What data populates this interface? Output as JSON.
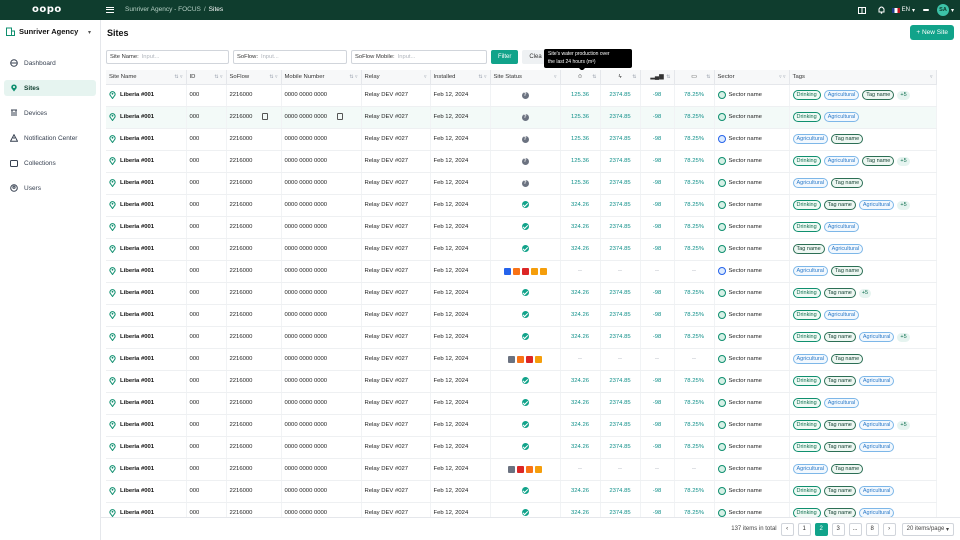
{
  "app": {
    "logo": "oopo"
  },
  "topbar": {
    "breadcrumb": [
      "Sunriver Agency - FOCUS",
      "/",
      "Sites"
    ],
    "lang": "EN",
    "badge": "",
    "avatar": "SA"
  },
  "sidebar": {
    "org_name": "Sunriver Agency",
    "items": [
      {
        "label": "Dashboard",
        "icon": "globe-icon"
      },
      {
        "label": "Sites",
        "icon": "pin-icon",
        "active": true
      },
      {
        "label": "Devices",
        "icon": "device-icon"
      },
      {
        "label": "Notification Center",
        "icon": "alert-icon"
      },
      {
        "label": "Collections",
        "icon": "collection-icon"
      },
      {
        "label": "Users",
        "icon": "user-icon"
      }
    ]
  },
  "page": {
    "title": "Sites",
    "new_button": "+ New Site"
  },
  "filters": {
    "site_name_label": "Site Name:",
    "site_name_ph": "Input...",
    "soflow_label": "SoFlow:",
    "soflow_ph": "Input...",
    "mobile_label": "SoFlow Mobile:",
    "mobile_ph": "Input...",
    "filter_btn": "Filter",
    "clear_btn": "Clea"
  },
  "tooltip": {
    "line1": "Site's water production over",
    "line2": "the last 24 hours (m³)"
  },
  "columns": [
    "Site Name",
    "ID",
    "SoFlow",
    "Mobile Number",
    "Relay",
    "Installed",
    "Site Status",
    "",
    "",
    "",
    "",
    "Sector",
    "Tags"
  ],
  "rows": [
    {
      "name": "Liberia #001",
      "id": "000",
      "soflow": "2216000",
      "mobile": "0000 0000 0000",
      "relay": "Relay DEV #027",
      "installed": "Feb 12, 2024",
      "status": "unknown",
      "v1": "125.36",
      "v2": "2374.85",
      "v3": "-98",
      "v4": "78.25%",
      "sector": "Sector name",
      "sc": "g",
      "tags": [
        "Drinking",
        "Agricultural",
        "Tag name"
      ],
      "more": "+5"
    },
    {
      "name": "Liberia #001",
      "id": "000",
      "soflow": "2216000",
      "mobile": "0000 0000 0000",
      "relay": "Relay DEV #027",
      "installed": "Feb 12, 2024",
      "status": "unknown",
      "v1": "125.36",
      "v2": "2374.85",
      "v3": "-98",
      "v4": "78.25%",
      "sector": "Sector name",
      "sc": "g",
      "tags": [
        "Drinking",
        "Agricultural"
      ],
      "more": "",
      "hl": true
    },
    {
      "name": "Liberia #001",
      "id": "000",
      "soflow": "2216000",
      "mobile": "0000 0000 0000",
      "relay": "Relay DEV #027",
      "installed": "Feb 12, 2024",
      "status": "unknown",
      "v1": "125.36",
      "v2": "2374.85",
      "v3": "-98",
      "v4": "78.25%",
      "sector": "Sector name",
      "sc": "b",
      "tags": [
        "Agricultural",
        "Tag name"
      ],
      "more": ""
    },
    {
      "name": "Liberia #001",
      "id": "000",
      "soflow": "2216000",
      "mobile": "0000 0000 0000",
      "relay": "Relay DEV #027",
      "installed": "Feb 12, 2024",
      "status": "unknown",
      "v1": "125.36",
      "v2": "2374.85",
      "v3": "-98",
      "v4": "78.25%",
      "sector": "Sector name",
      "sc": "g",
      "tags": [
        "Drinking",
        "Agricultural",
        "Tag name"
      ],
      "more": "+5"
    },
    {
      "name": "Liberia #001",
      "id": "000",
      "soflow": "2216000",
      "mobile": "0000 0000 0000",
      "relay": "Relay DEV #027",
      "installed": "Feb 12, 2024",
      "status": "unknown",
      "v1": "125.36",
      "v2": "2374.85",
      "v3": "-98",
      "v4": "78.25%",
      "sector": "Sector name",
      "sc": "g",
      "tags": [
        "Agricultural",
        "Tag name"
      ],
      "more": ""
    },
    {
      "name": "Liberia #001",
      "id": "000",
      "soflow": "2216000",
      "mobile": "0000 0000 0000",
      "relay": "Relay DEV #027",
      "installed": "Feb 12, 2024",
      "status": "ok",
      "v1": "324.26",
      "v2": "2374.85",
      "v3": "-98",
      "v4": "78.25%",
      "sector": "Sector name",
      "sc": "g",
      "tags": [
        "Drinking",
        "Tag name",
        "Agricultural"
      ],
      "more": "+5"
    },
    {
      "name": "Liberia #001",
      "id": "000",
      "soflow": "2216000",
      "mobile": "0000 0000 0000",
      "relay": "Relay DEV #027",
      "installed": "Feb 12, 2024",
      "status": "ok",
      "v1": "324.26",
      "v2": "2374.85",
      "v3": "-98",
      "v4": "78.25%",
      "sector": "Sector name",
      "sc": "g",
      "tags": [
        "Drinking",
        "Agricultural"
      ],
      "more": ""
    },
    {
      "name": "Liberia #001",
      "id": "000",
      "soflow": "2216000",
      "mobile": "0000 0000 0000",
      "relay": "Relay DEV #027",
      "installed": "Feb 12, 2024",
      "status": "ok",
      "v1": "324.26",
      "v2": "2374.85",
      "v3": "-98",
      "v4": "78.25%",
      "sector": "Sector name",
      "sc": "g",
      "tags": [
        "Tag name",
        "Agricultural"
      ],
      "more": ""
    },
    {
      "name": "Liberia #001",
      "id": "000",
      "soflow": "2216000",
      "mobile": "0000 0000 0000",
      "relay": "Relay DEV #027",
      "installed": "Feb 12, 2024",
      "status": "alerts",
      "v1": "--",
      "v2": "--",
      "v3": "--",
      "v4": "--",
      "sector": "Sector name",
      "sc": "b",
      "tags": [
        "Agricultural",
        "Tag name"
      ],
      "more": ""
    },
    {
      "name": "Liberia #001",
      "id": "000",
      "soflow": "2216000",
      "mobile": "0000 0000 0000",
      "relay": "Relay DEV #027",
      "installed": "Feb 12, 2024",
      "status": "ok",
      "v1": "324.26",
      "v2": "2374.85",
      "v3": "-98",
      "v4": "78.25%",
      "sector": "Sector name",
      "sc": "g",
      "tags": [
        "Drinking",
        "Tag name"
      ],
      "more": "+5"
    },
    {
      "name": "Liberia #001",
      "id": "000",
      "soflow": "2216000",
      "mobile": "0000 0000 0000",
      "relay": "Relay DEV #027",
      "installed": "Feb 12, 2024",
      "status": "ok",
      "v1": "324.26",
      "v2": "2374.85",
      "v3": "-98",
      "v4": "78.25%",
      "sector": "Sector name",
      "sc": "g",
      "tags": [
        "Drinking",
        "Agricultural"
      ],
      "more": ""
    },
    {
      "name": "Liberia #001",
      "id": "000",
      "soflow": "2216000",
      "mobile": "0000 0000 0000",
      "relay": "Relay DEV #027",
      "installed": "Feb 12, 2024",
      "status": "ok",
      "v1": "324.26",
      "v2": "2374.85",
      "v3": "-98",
      "v4": "78.25%",
      "sector": "Sector name",
      "sc": "g",
      "tags": [
        "Drinking",
        "Tag name",
        "Agricultural"
      ],
      "more": "+5"
    },
    {
      "name": "Liberia #001",
      "id": "000",
      "soflow": "2216000",
      "mobile": "0000 0000 0000",
      "relay": "Relay DEV #027",
      "installed": "Feb 12, 2024",
      "status": "alerts2",
      "v1": "--",
      "v2": "--",
      "v3": "--",
      "v4": "--",
      "sector": "Sector name",
      "sc": "g",
      "tags": [
        "Agricultural",
        "Tag name"
      ],
      "more": ""
    },
    {
      "name": "Liberia #001",
      "id": "000",
      "soflow": "2216000",
      "mobile": "0000 0000 0000",
      "relay": "Relay DEV #027",
      "installed": "Feb 12, 2024",
      "status": "ok",
      "v1": "324.26",
      "v2": "2374.85",
      "v3": "-98",
      "v4": "78.25%",
      "sector": "Sector name",
      "sc": "g",
      "tags": [
        "Drinking",
        "Tag name",
        "Agricultural"
      ],
      "more": ""
    },
    {
      "name": "Liberia #001",
      "id": "000",
      "soflow": "2216000",
      "mobile": "0000 0000 0000",
      "relay": "Relay DEV #027",
      "installed": "Feb 12, 2024",
      "status": "ok",
      "v1": "324.26",
      "v2": "2374.85",
      "v3": "-98",
      "v4": "78.25%",
      "sector": "Sector name",
      "sc": "g",
      "tags": [
        "Drinking",
        "Agricultural"
      ],
      "more": ""
    },
    {
      "name": "Liberia #001",
      "id": "000",
      "soflow": "2216000",
      "mobile": "0000 0000 0000",
      "relay": "Relay DEV #027",
      "installed": "Feb 12, 2024",
      "status": "ok",
      "v1": "324.26",
      "v2": "2374.85",
      "v3": "-98",
      "v4": "78.25%",
      "sector": "Sector name",
      "sc": "g",
      "tags": [
        "Drinking",
        "Tag name",
        "Agricultural"
      ],
      "more": "+5"
    },
    {
      "name": "Liberia #001",
      "id": "000",
      "soflow": "2216000",
      "mobile": "0000 0000 0000",
      "relay": "Relay DEV #027",
      "installed": "Feb 12, 2024",
      "status": "ok",
      "v1": "324.26",
      "v2": "2374.85",
      "v3": "-98",
      "v4": "78.25%",
      "sector": "Sector name",
      "sc": "g",
      "tags": [
        "Drinking",
        "Tag name",
        "Agricultural"
      ],
      "more": ""
    },
    {
      "name": "Liberia #001",
      "id": "000",
      "soflow": "2216000",
      "mobile": "0000 0000 0000",
      "relay": "Relay DEV #027",
      "installed": "Feb 12, 2024",
      "status": "alerts3",
      "v1": "--",
      "v2": "--",
      "v3": "--",
      "v4": "--",
      "sector": "Sector name",
      "sc": "g",
      "tags": [
        "Agricultural",
        "Tag name"
      ],
      "more": ""
    },
    {
      "name": "Liberia #001",
      "id": "000",
      "soflow": "2216000",
      "mobile": "0000 0000 0000",
      "relay": "Relay DEV #027",
      "installed": "Feb 12, 2024",
      "status": "ok",
      "v1": "324.26",
      "v2": "2374.85",
      "v3": "-98",
      "v4": "78.25%",
      "sector": "Sector name",
      "sc": "g",
      "tags": [
        "Drinking",
        "Tag name",
        "Agricultural"
      ],
      "more": ""
    },
    {
      "name": "Liberia #001",
      "id": "000",
      "soflow": "2216000",
      "mobile": "0000 0000 0000",
      "relay": "Relay DEV #027",
      "installed": "Feb 12, 2024",
      "status": "ok",
      "v1": "324.26",
      "v2": "2374.85",
      "v3": "-98",
      "v4": "78.25%",
      "sector": "Sector name",
      "sc": "g",
      "tags": [
        "Drinking",
        "Tag name",
        "Agricultural"
      ],
      "more": ""
    }
  ],
  "footer": {
    "total": "137 items in total",
    "pages": [
      "1",
      "2",
      "3",
      "...",
      "8"
    ],
    "active_page": "2",
    "page_size": "20 items/page"
  },
  "colors": {
    "brand": "#0f3d2e",
    "accent": "#11a38a"
  }
}
